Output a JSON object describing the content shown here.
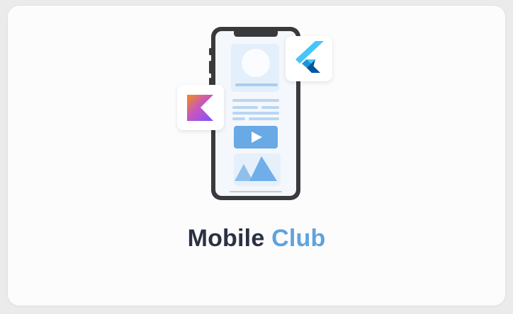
{
  "card": {
    "title_word_1": "Mobile",
    "title_word_2": "Club"
  },
  "illustration": {
    "icons": [
      "smartphone-icon",
      "kotlin-logo-icon",
      "flutter-logo-icon",
      "play-icon",
      "image-icon"
    ]
  },
  "colors": {
    "title_dark": "#2a3142",
    "title_accent": "#5ea3dd",
    "phone_frame": "#3a3a3c",
    "screen_accent": "#68a9e6"
  }
}
